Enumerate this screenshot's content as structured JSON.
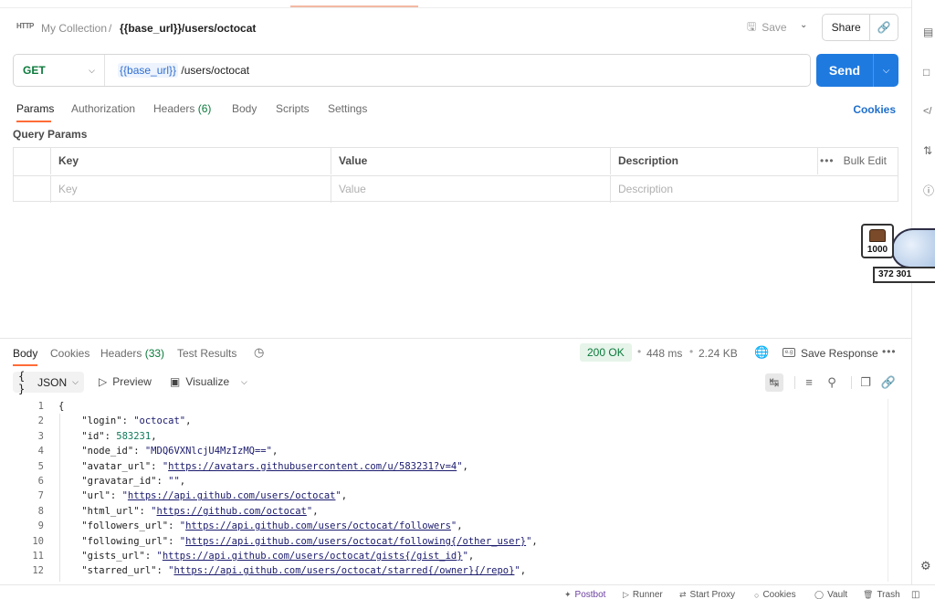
{
  "header": {
    "http_badge": "HTTP",
    "collection": "My Collection",
    "separator": "/",
    "request_name": "{{base_url}}/users/octocat",
    "save_label": "Save",
    "share_label": "Share"
  },
  "url_bar": {
    "method": "GET",
    "url_var": "{{base_url}}",
    "url_path": "/users/octocat",
    "send_label": "Send"
  },
  "request_tabs": {
    "params": "Params",
    "authorization": "Authorization",
    "headers": "Headers",
    "headers_count": "(6)",
    "body": "Body",
    "scripts": "Scripts",
    "settings": "Settings",
    "cookies": "Cookies"
  },
  "query_params": {
    "title": "Query Params",
    "columns": {
      "key": "Key",
      "value": "Value",
      "description": "Description"
    },
    "bulk_edit": "Bulk Edit",
    "placeholders": {
      "key": "Key",
      "value": "Value",
      "description": "Description"
    }
  },
  "widget": {
    "count": "1000",
    "score": "372 301"
  },
  "response": {
    "tabs": {
      "body": "Body",
      "cookies": "Cookies",
      "headers": "Headers",
      "headers_count": "(33)",
      "test_results": "Test Results"
    },
    "status": "200 OK",
    "time": "448 ms",
    "size": "2.24 KB",
    "save_response": "Save Response",
    "format": "JSON",
    "preview": "Preview",
    "visualize": "Visualize",
    "lines": [
      {
        "n": "1",
        "text": "{"
      },
      {
        "n": "2",
        "key": "\"login\"",
        "val": "\"octocat\"",
        "kind": "s",
        "end": ","
      },
      {
        "n": "3",
        "key": "\"id\"",
        "val": "583231",
        "kind": "n",
        "end": ","
      },
      {
        "n": "4",
        "key": "\"node_id\"",
        "val": "\"MDQ6VXNlcjU4MzIzMQ==\"",
        "kind": "s",
        "end": ","
      },
      {
        "n": "5",
        "key": "\"avatar_url\"",
        "val": "https://avatars.githubusercontent.com/u/583231?v=4",
        "kind": "u",
        "end": ","
      },
      {
        "n": "6",
        "key": "\"gravatar_id\"",
        "val": "\"\"",
        "kind": "s",
        "end": ","
      },
      {
        "n": "7",
        "key": "\"url\"",
        "val": "https://api.github.com/users/octocat",
        "kind": "u",
        "end": ","
      },
      {
        "n": "8",
        "key": "\"html_url\"",
        "val": "https://github.com/octocat",
        "kind": "u",
        "end": ","
      },
      {
        "n": "9",
        "key": "\"followers_url\"",
        "val": "https://api.github.com/users/octocat/followers",
        "kind": "u",
        "end": ","
      },
      {
        "n": "10",
        "key": "\"following_url\"",
        "val": "https://api.github.com/users/octocat/following{/other_user}",
        "kind": "u",
        "end": ","
      },
      {
        "n": "11",
        "key": "\"gists_url\"",
        "val": "https://api.github.com/users/octocat/gists{/gist_id}",
        "kind": "u",
        "end": ","
      },
      {
        "n": "12",
        "key": "\"starred_url\"",
        "val": "https://api.github.com/users/octocat/starred{/owner}{/repo}",
        "kind": "u",
        "end": ","
      }
    ]
  },
  "statusbar": {
    "postbot": "Postbot",
    "runner": "Runner",
    "start_proxy": "Start Proxy",
    "cookies": "Cookies",
    "vault": "Vault",
    "trash": "Trash"
  },
  "colors": {
    "accent": "#ff6c37",
    "send": "#1f7ae0",
    "method_get": "#0b7a3b",
    "status_ok_bg": "#e6f4ea"
  }
}
